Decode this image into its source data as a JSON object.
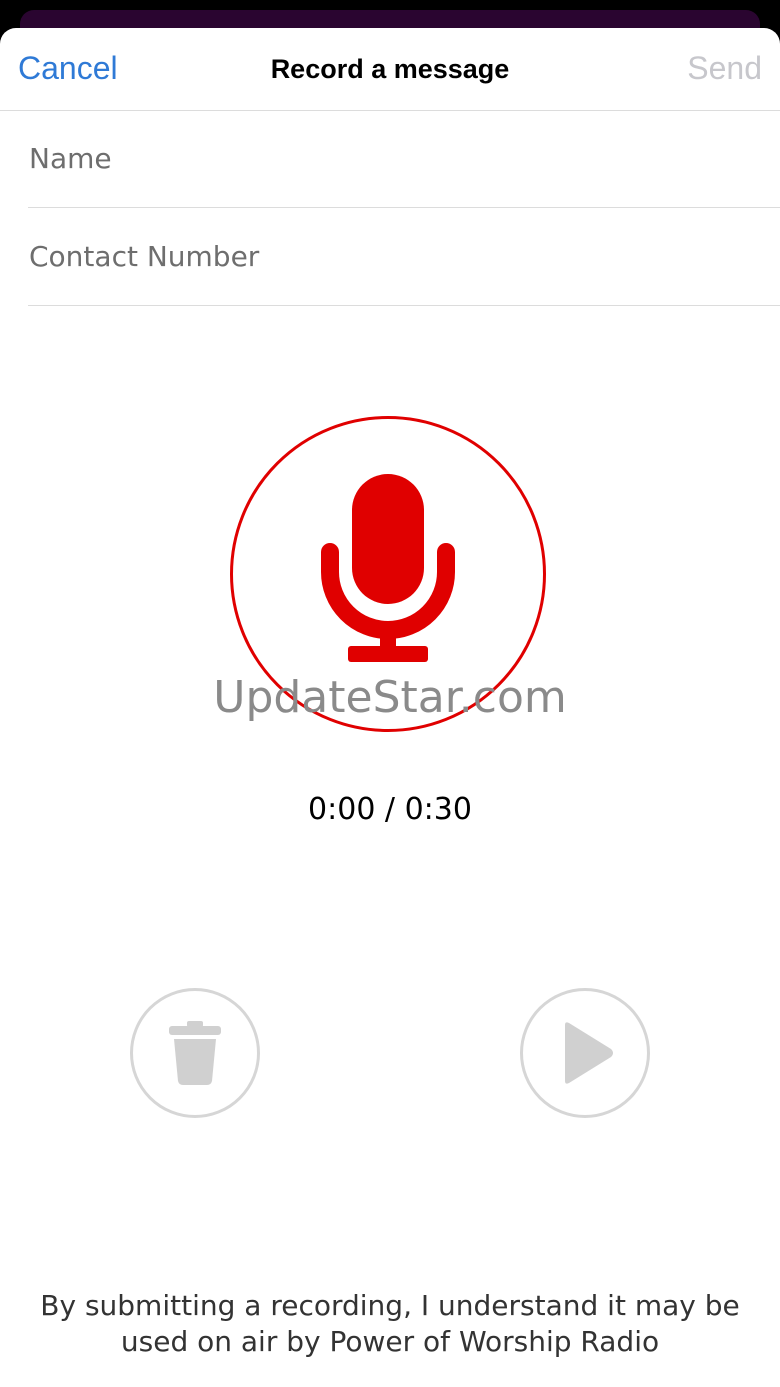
{
  "header": {
    "cancel_label": "Cancel",
    "title": "Record a message",
    "send_label": "Send"
  },
  "form": {
    "name_placeholder": "Name",
    "contact_placeholder": "Contact Number"
  },
  "recorder": {
    "mic_icon": "microphone-icon",
    "accent_color": "#e00000",
    "watermark": "UpdateStar.com",
    "timer": "0:00 / 0:30",
    "delete_icon": "trash-icon",
    "play_icon": "play-icon"
  },
  "footer": {
    "disclaimer": "By submitting a recording, I understand it may be used on air by Power of Worship Radio"
  }
}
